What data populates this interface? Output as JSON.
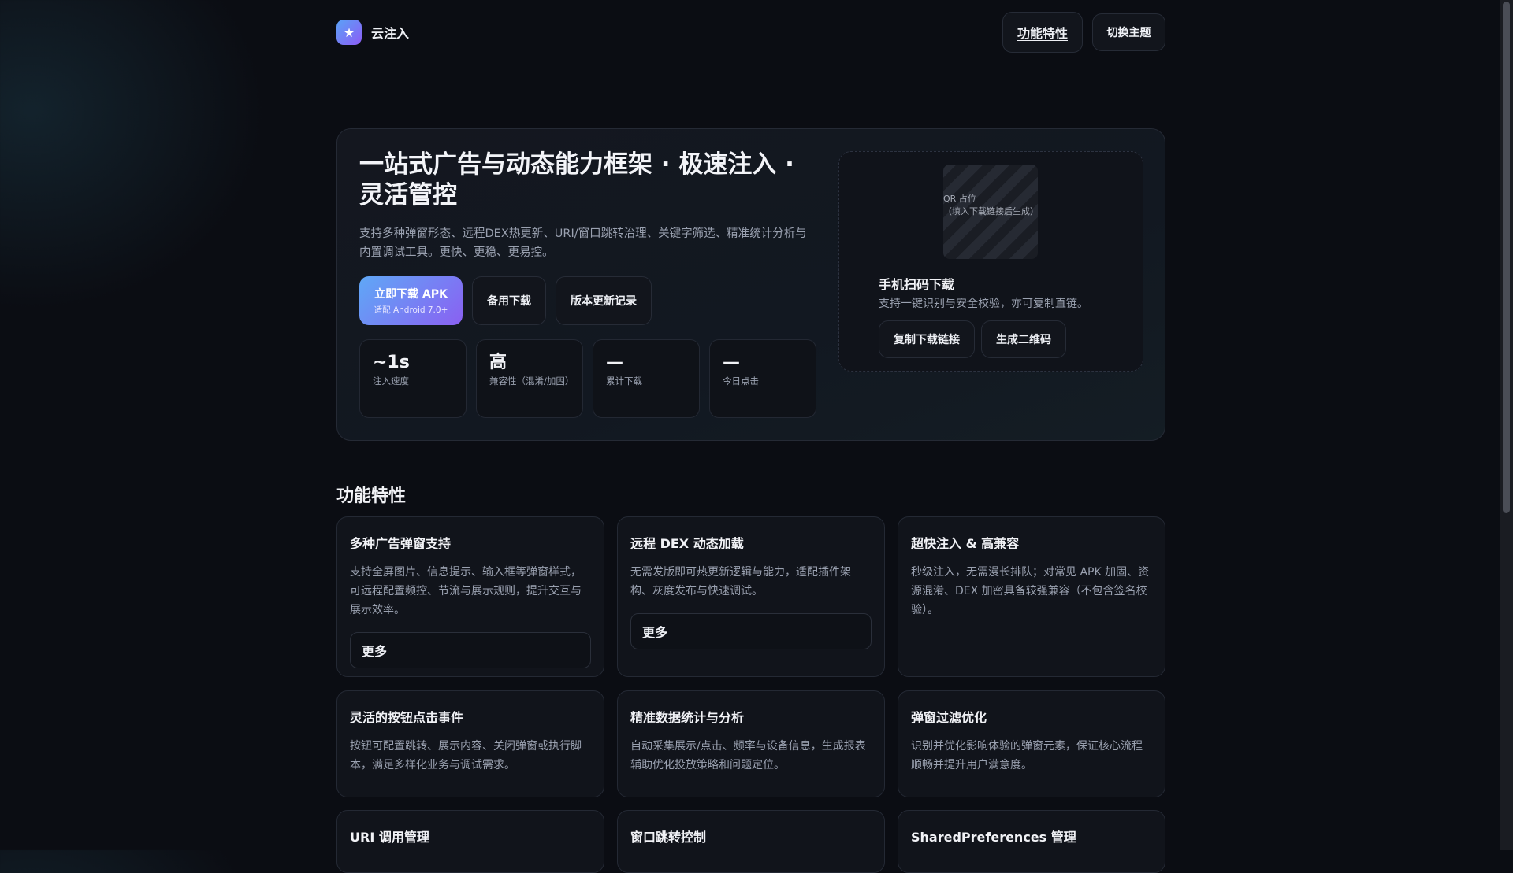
{
  "header": {
    "logo_icon": "star-icon",
    "brand_name": "云注入",
    "nav_features": "功能特性",
    "nav_theme": "切换主题"
  },
  "hero": {
    "title": "一站式广告与动态能力框架 · 极速注入 · 灵活管控",
    "description": "支持多种弹窗形态、远程DEX热更新、URI/窗口跳转治理、关键字筛选、精准统计分析与内置调试工具。更快、更稳、更易控。",
    "primary_button": {
      "label": "立即下载 APK",
      "sub": "适配 Android 7.0+"
    },
    "backup_button": "备用下载",
    "changelog_button": "版本更新记录",
    "stats": [
      {
        "value": "~1s",
        "label": "注入速度"
      },
      {
        "value": "高",
        "label": "兼容性（混淆/加固）"
      },
      {
        "value": "—",
        "label": "累计下载"
      },
      {
        "value": "—",
        "label": "今日点击"
      }
    ],
    "qr": {
      "placeholder_line1": "QR 占位",
      "placeholder_line2": "（填入下载链接后生成）",
      "title": "手机扫码下载",
      "description": "支持一键识别与安全校验，亦可复制直链。",
      "copy_button": "复制下载链接",
      "generate_button": "生成二维码"
    }
  },
  "features": {
    "title": "功能特性",
    "more_label": "更多",
    "cards": [
      {
        "title": "多种广告弹窗支持",
        "desc": "支持全屏图片、信息提示、输入框等弹窗样式，可远程配置频控、节流与展示规则，提升交互与展示效率。"
      },
      {
        "title": "远程 DEX 动态加载",
        "desc": "无需发版即可热更新逻辑与能力，适配插件架构、灰度发布与快速调试。"
      },
      {
        "title": "超快注入 & 高兼容",
        "desc": "秒级注入，无需漫长排队；对常见 APK 加固、资源混淆、DEX 加密具备较强兼容（不包含签名校验）。"
      },
      {
        "title": "灵活的按钮点击事件",
        "desc": "按钮可配置跳转、展示内容、关闭弹窗或执行脚本，满足多样化业务与调试需求。"
      },
      {
        "title": "精准数据统计与分析",
        "desc": "自动采集展示/点击、频率与设备信息，生成报表辅助优化投放策略和问题定位。"
      },
      {
        "title": "弹窗过滤优化",
        "desc": "识别并优化影响体验的弹窗元素，保证核心流程顺畅并提升用户满意度。"
      },
      {
        "title": "URI 调用管理",
        "desc": ""
      },
      {
        "title": "窗口跳转控制",
        "desc": ""
      },
      {
        "title": "SharedPreferences 管理",
        "desc": ""
      }
    ]
  }
}
